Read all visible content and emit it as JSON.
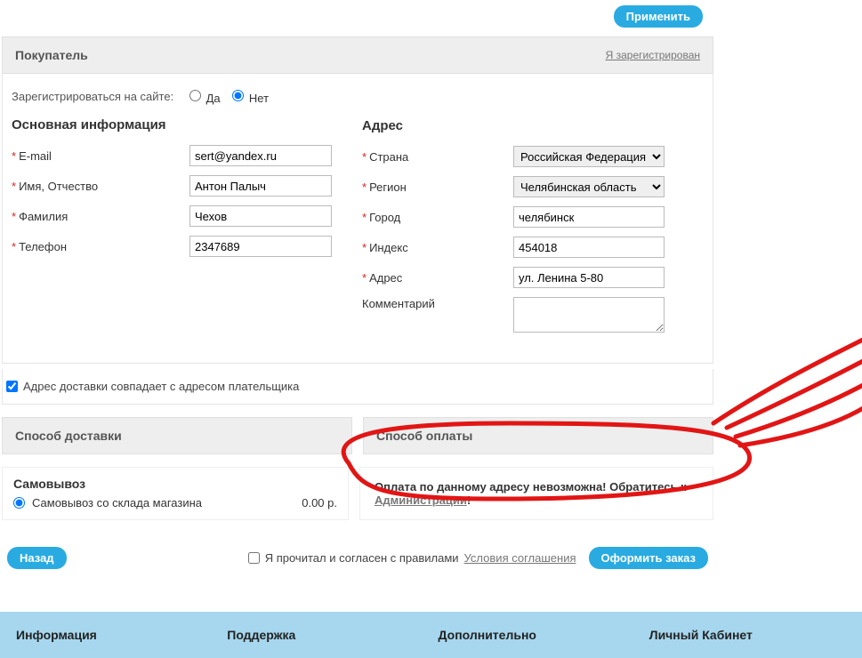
{
  "top": {
    "apply": "Применить"
  },
  "buyer": {
    "title": "Покупатель",
    "registered_link": "Я зарегистрирован"
  },
  "register": {
    "label": "Зарегистрироваться на сайте:",
    "yes": "Да",
    "no": "Нет",
    "selected": "no"
  },
  "main_info": {
    "title": "Основная информация",
    "email_label": "E-mail",
    "email_value": "sert@yandex.ru",
    "name_label": "Имя, Отчество",
    "name_value": "Антон Палыч",
    "surname_label": "Фамилия",
    "surname_value": "Чехов",
    "phone_label": "Телефон",
    "phone_value": "2347689"
  },
  "address": {
    "title": "Адрес",
    "country_label": "Страна",
    "country_value": "Российская Федерация",
    "region_label": "Регион",
    "region_value": "Челябинская область",
    "city_label": "Город",
    "city_value": "челябинск",
    "index_label": "Индекс",
    "index_value": "454018",
    "addr_label": "Адрес",
    "addr_value": "ул. Ленина 5-80",
    "comment_label": "Комментарий",
    "comment_value": ""
  },
  "same_addr": {
    "label": "Адрес доставки совпадает с адресом плательщика",
    "checked": true
  },
  "shipping": {
    "title": "Способ доставки",
    "sub_title": "Самовывоз",
    "option_label": "Самовывоз со склада магазина",
    "price": "0.00 р."
  },
  "payment": {
    "title": "Способ оплаты",
    "warning_text": "Оплата по данному адресу невозможна! Обратитесь к ",
    "admin_link": "Администрации",
    "exclam": "!"
  },
  "bottom": {
    "back": "Назад",
    "agree_text": "Я прочитал и согласен с правилами ",
    "terms_link": "Условия соглашения",
    "submit": "Оформить заказ"
  },
  "footer": {
    "col1": "Информация",
    "col2": "Поддержка",
    "col3": "Дополнительно",
    "col4": "Личный Кабинет"
  }
}
